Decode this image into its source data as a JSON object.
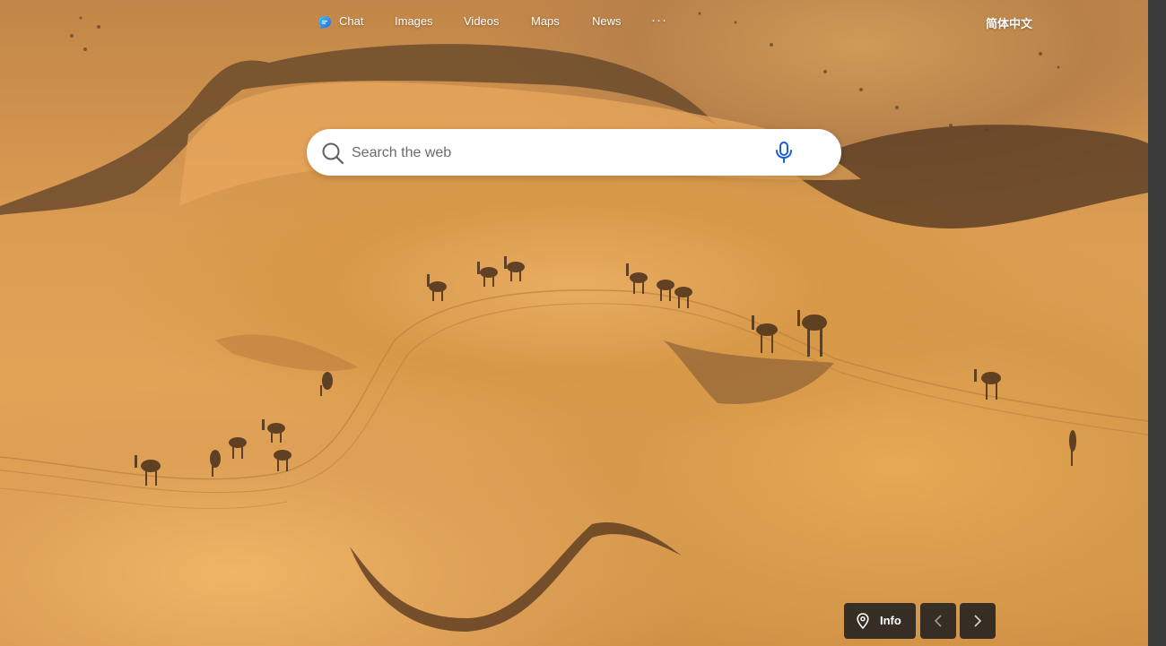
{
  "nav": {
    "items": [
      {
        "label": "Chat",
        "icon": "copilot-chat-icon"
      },
      {
        "label": "Images"
      },
      {
        "label": "Videos"
      },
      {
        "label": "Maps"
      },
      {
        "label": "News"
      }
    ],
    "more_label": "···",
    "language_label": "简体中文"
  },
  "search": {
    "placeholder": "Search the web",
    "search_icon": "search-icon",
    "mic_icon": "microphone-icon"
  },
  "background": {
    "scene": "desert-dunes-with-camel-caravan",
    "colors": {
      "sand_light": "#e9ad62",
      "sand": "#d79847",
      "shadow": "#6a4a2a"
    }
  },
  "footer": {
    "info_label": "Info",
    "info_icon": "location-pin-icon",
    "prev_icon": "chevron-left-icon",
    "next_icon": "chevron-right-icon"
  }
}
